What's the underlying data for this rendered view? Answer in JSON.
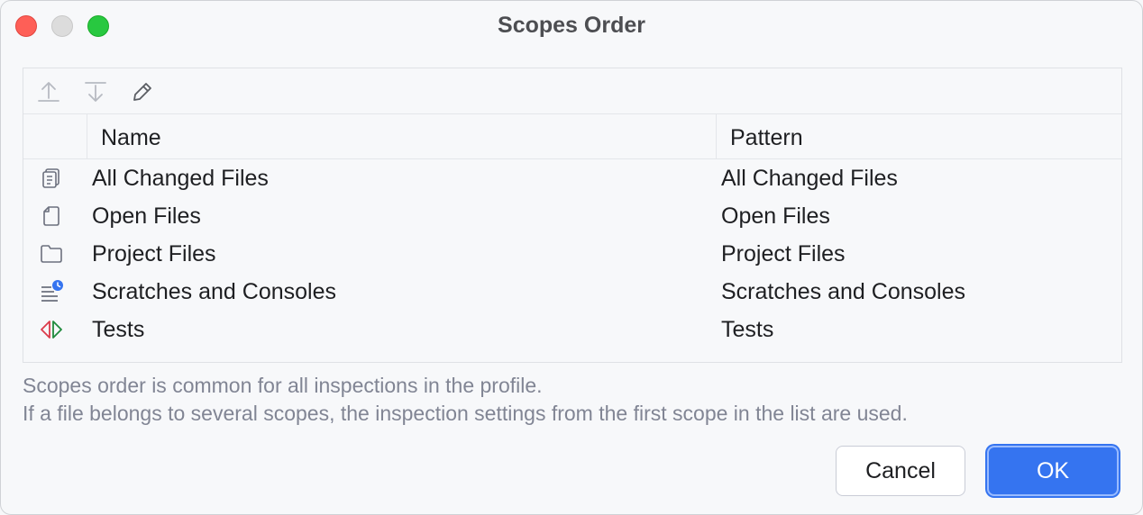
{
  "window": {
    "title": "Scopes Order"
  },
  "toolbar": {
    "items": [
      {
        "name": "move-up",
        "icon": "arrow-up-icon"
      },
      {
        "name": "move-down",
        "icon": "arrow-down-icon"
      },
      {
        "name": "edit",
        "icon": "pencil-icon"
      }
    ]
  },
  "table": {
    "columns": [
      "Name",
      "Pattern"
    ],
    "rows": [
      {
        "icon": "changed-files-icon",
        "name": "All Changed Files",
        "pattern": "All Changed Files"
      },
      {
        "icon": "open-file-icon",
        "name": "Open Files",
        "pattern": "Open Files"
      },
      {
        "icon": "folder-icon",
        "name": "Project Files",
        "pattern": "Project Files"
      },
      {
        "icon": "scratches-icon",
        "name": "Scratches and Consoles",
        "pattern": "Scratches and Consoles"
      },
      {
        "icon": "tests-icon",
        "name": "Tests",
        "pattern": "Tests"
      }
    ]
  },
  "hint": {
    "line1": "Scopes order is common for all inspections in the profile.",
    "line2": "If a file belongs to several scopes, the inspection settings from the first scope in the list are used."
  },
  "buttons": {
    "cancel": "Cancel",
    "ok": "OK"
  },
  "colors": {
    "accent": "#3574f0",
    "close": "#fe5f57",
    "zoom": "#28c840",
    "tests_red": "#db3b4b",
    "tests_green": "#208a3c"
  }
}
